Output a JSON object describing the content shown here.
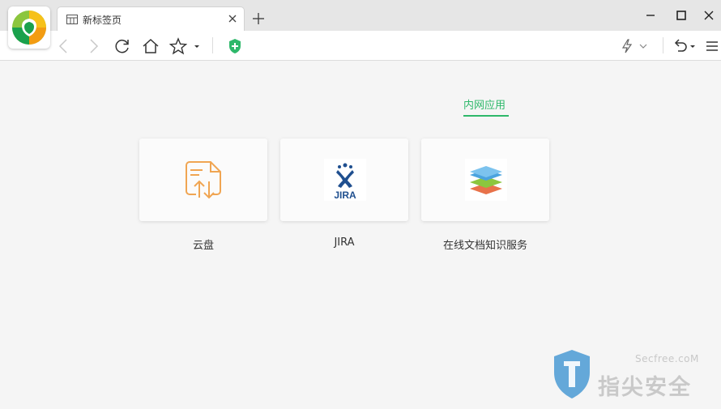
{
  "tab": {
    "title": "新标签页"
  },
  "content": {
    "section_tab": "内网应用",
    "apps": [
      {
        "label": "云盘",
        "icon": "cloud-drive-icon"
      },
      {
        "label": "JIRA",
        "icon": "jira-icon",
        "logo_text": "JIRA"
      },
      {
        "label": "在线文档知识服务",
        "icon": "layers-docs-icon"
      }
    ]
  },
  "watermark": {
    "site": "Secfree.coM",
    "text": "指尖安全"
  },
  "colors": {
    "accent": "#2eb86a",
    "cloud_icon": "#f0a552",
    "jira": "#1f4f8f"
  }
}
